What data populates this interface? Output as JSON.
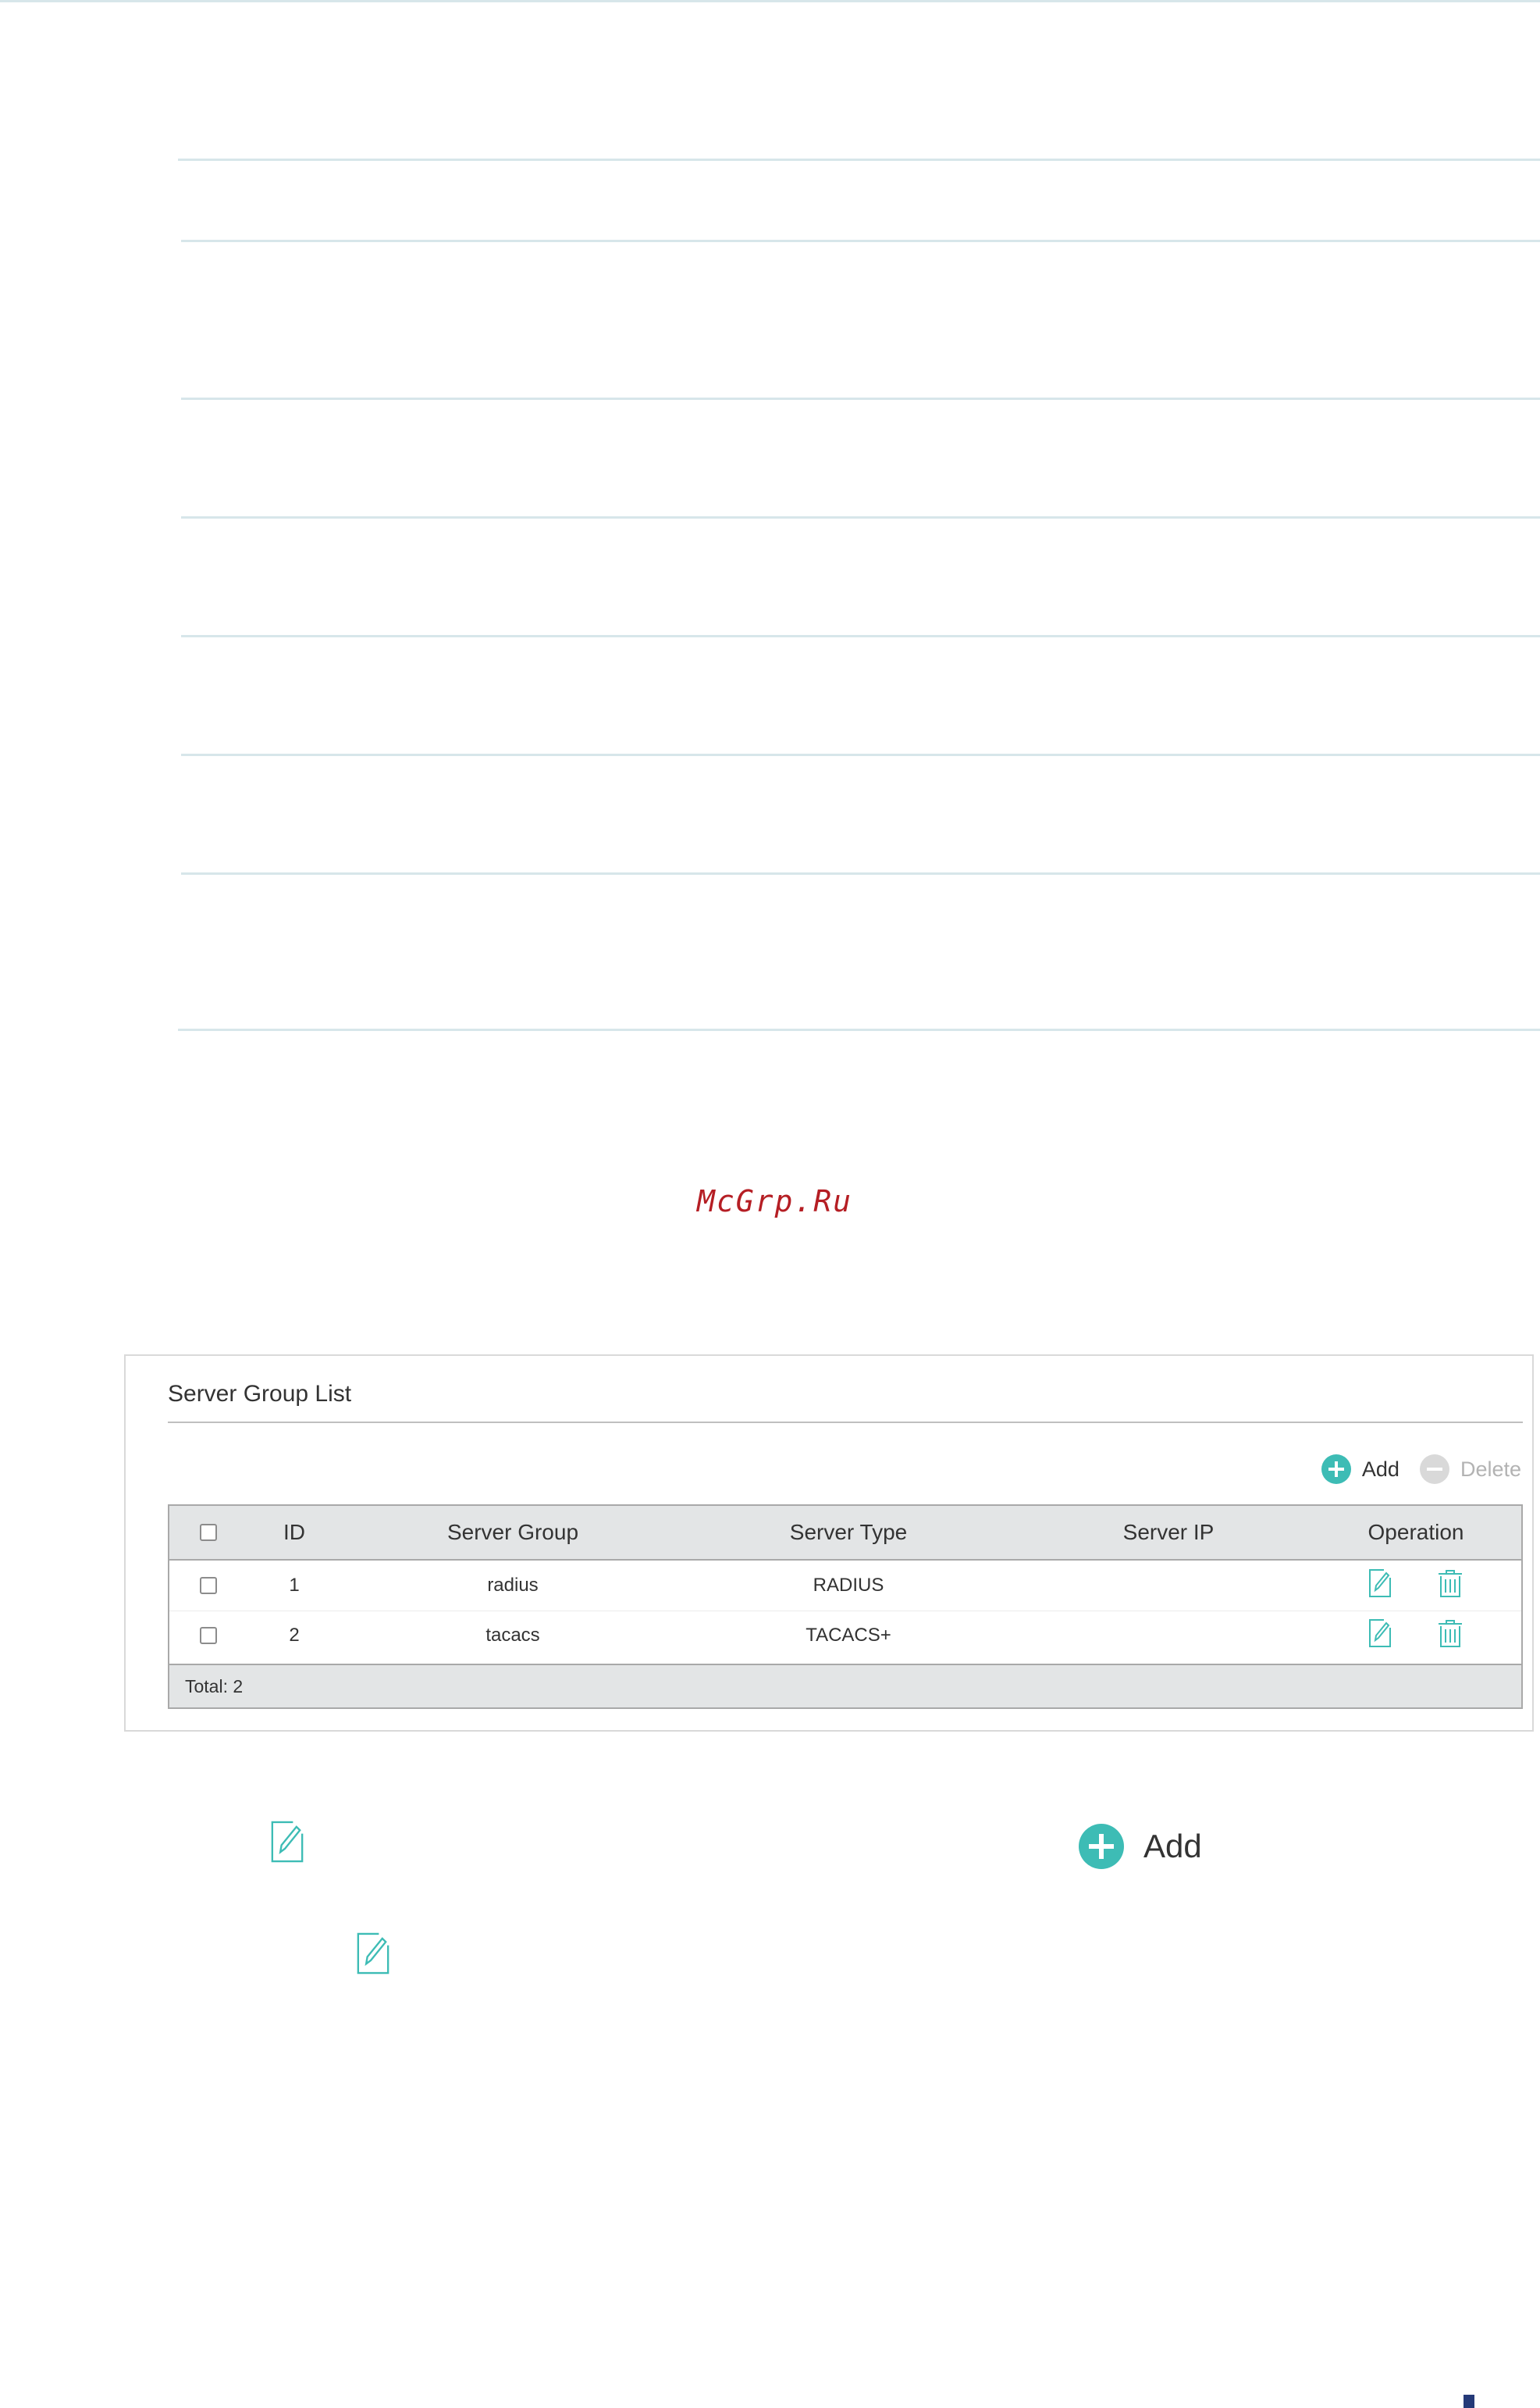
{
  "watermark": "McGrp.Ru",
  "server_group_list": {
    "title": "Server Group List",
    "toolbar": {
      "add_label": "Add",
      "delete_label": "Delete"
    },
    "columns": [
      "ID",
      "Server Group",
      "Server Type",
      "Server IP",
      "Operation"
    ],
    "rows": [
      {
        "id": "1",
        "server_group": "radius",
        "server_type": "RADIUS",
        "server_ip": ""
      },
      {
        "id": "2",
        "server_group": "tacacs",
        "server_type": "TACACS+",
        "server_ip": ""
      }
    ],
    "footer": "Total: 2"
  },
  "legend": {
    "add_label": "Add"
  },
  "colors": {
    "accent": "#3dbcb5",
    "header_bg": "#e3e5e6",
    "rule": "#d7e6ea",
    "watermark": "#b51e24"
  },
  "icons": [
    "edit-icon",
    "trash-icon",
    "add-circle-icon",
    "delete-circle-icon"
  ]
}
